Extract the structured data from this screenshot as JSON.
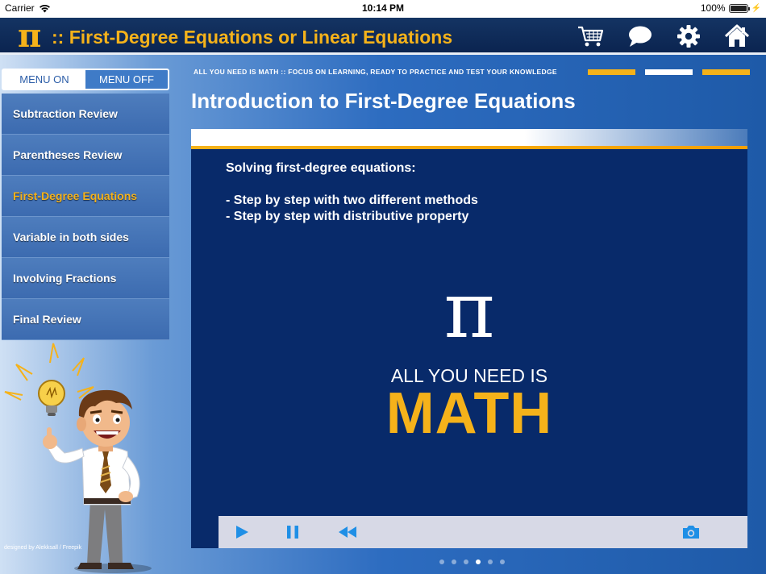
{
  "statusbar": {
    "carrier": "Carrier",
    "time": "10:14 PM",
    "battery": "100%"
  },
  "header": {
    "logo": "π",
    "title": ":: First-Degree Equations or Linear Equations",
    "icons": [
      "cart-icon",
      "chat-bubble-icon",
      "gear-icon",
      "home-icon"
    ]
  },
  "menu_toggle": {
    "on_label": "MENU ON",
    "off_label": "MENU OFF",
    "selected": "MENU ON"
  },
  "sidebar": {
    "items": [
      {
        "label": "Subtraction Review"
      },
      {
        "label": "Parentheses Review"
      },
      {
        "label": "First-Degree Equations"
      },
      {
        "label": "Variable in both sides"
      },
      {
        "label": "Involving Fractions"
      },
      {
        "label": "Final Review"
      }
    ],
    "active_index": 2,
    "credit": "designed by Alekksall / Freepik"
  },
  "tagline": "ALL YOU NEED IS MATH :: FOCUS ON LEARNING, READY TO PRACTICE AND TEST YOUR KNOWLEDGE",
  "lesson_title": "Introduction to First-Degree Equations",
  "video": {
    "heading": "Solving first-degree equations:",
    "bullets": [
      "- Step by step with two different methods",
      "- Step by step with distributive property"
    ],
    "pi": "π",
    "slogan": "ALL YOU NEED IS",
    "math": "MATH",
    "controls": [
      "play-icon",
      "pause-icon",
      "rewind-icon",
      "camera-icon"
    ]
  },
  "pages": {
    "count": 6,
    "current": 4
  },
  "colors": {
    "accent": "#f5b21a",
    "header_bg": "#0b2450",
    "video_bg": "#082a6a",
    "control_icon": "#1f8fe6"
  }
}
